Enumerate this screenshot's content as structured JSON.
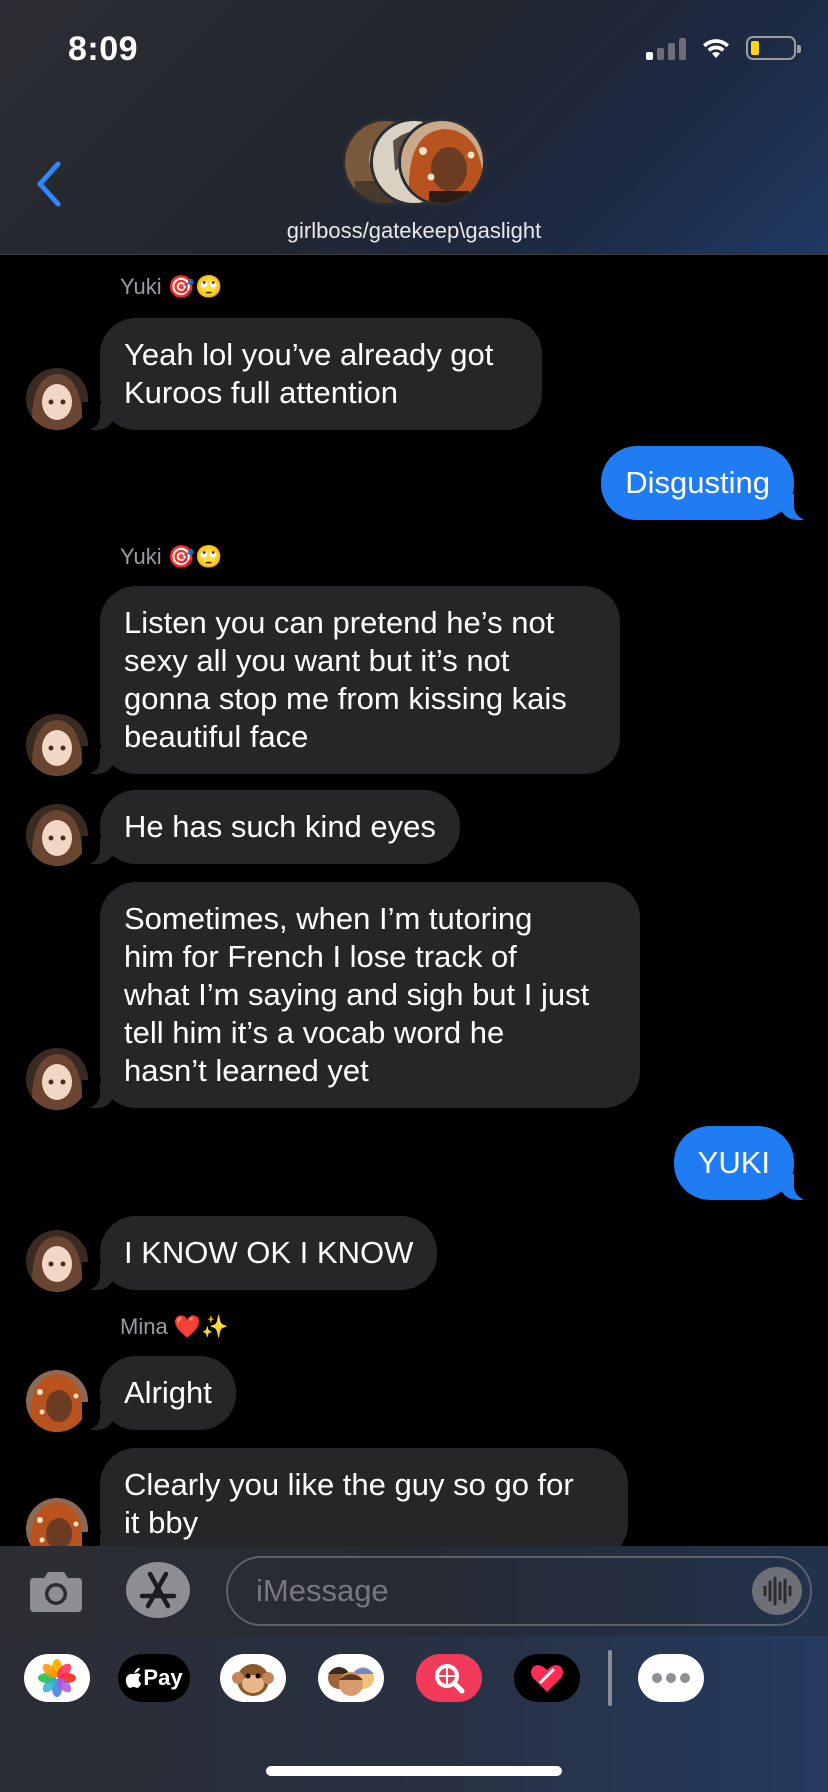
{
  "status_bar": {
    "time": "8:09",
    "battery_level_fraction": 0.15,
    "signal_bars_active": 1,
    "signal_bars_total": 4
  },
  "header": {
    "back_icon": "chevron-left-icon",
    "group_name": "girlboss/gatekeep\\gaslight",
    "avatar_count": 3
  },
  "messages": [
    {
      "type": "sender",
      "name": "Yuki",
      "emojis": "🎯🙄"
    },
    {
      "type": "in",
      "text": "Yeah lol you’ve already got\nKuroos full attention",
      "avatar": "yuki-avatar"
    },
    {
      "type": "out",
      "text": "Disgusting"
    },
    {
      "type": "sender",
      "name": "Yuki",
      "emojis": "🎯🙄"
    },
    {
      "type": "in",
      "text": "Listen you can pretend he’s not\nsexy all you want but it’s not\ngonna stop me from kissing kais\nbeautiful face",
      "avatar": "yuki-avatar"
    },
    {
      "type": "in",
      "text": "He has such kind eyes",
      "avatar": "yuki-avatar"
    },
    {
      "type": "in",
      "text": "Sometimes, when I’m tutoring\nhim for French I lose track of\nwhat I’m saying and sigh but I just\ntell him it’s a vocab word he\nhasn’t learned yet",
      "avatar": "yuki-avatar"
    },
    {
      "type": "out",
      "text": "YUKI"
    },
    {
      "type": "in",
      "text": "I KNOW OK I KNOW",
      "avatar": "yuki-avatar"
    },
    {
      "type": "sender",
      "name": "Mina",
      "emojis": "❤️✨"
    },
    {
      "type": "in",
      "text": "Alright",
      "avatar": "mina-avatar"
    },
    {
      "type": "in",
      "text": "Clearly you like the guy so go for\nit bby",
      "avatar": "mina-avatar"
    }
  ],
  "input_bar": {
    "camera_icon": "camera-icon",
    "apps_icon": "app-store-icon",
    "placeholder": "iMessage",
    "voice_icon": "waveform-icon"
  },
  "app_drawer": {
    "apps": [
      {
        "name": "photos-app-icon"
      },
      {
        "name": "apple-pay-app-icon",
        "label": "Pay"
      },
      {
        "name": "animoji-app-icon"
      },
      {
        "name": "memoji-app-icon"
      },
      {
        "name": "image-search-app-icon"
      },
      {
        "name": "digital-touch-app-icon"
      },
      {
        "name": "more-apps-icon"
      }
    ]
  },
  "colors": {
    "outgoing_bubble": "#1f7cf2",
    "incoming_bubble": "#262628",
    "accent": "#2f86ff"
  }
}
